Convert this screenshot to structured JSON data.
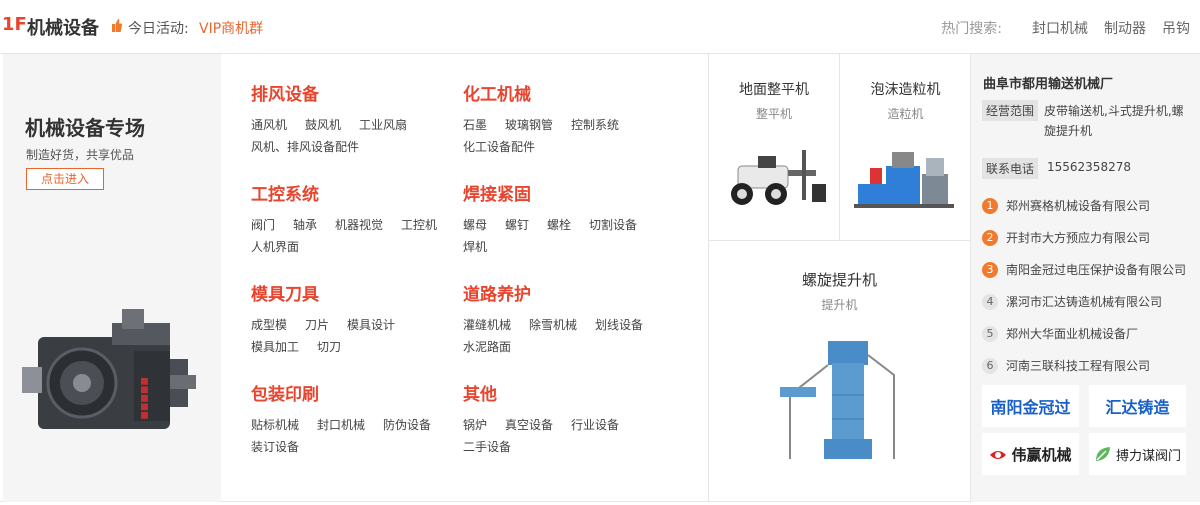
{
  "header": {
    "floor": "1F",
    "title": "机械设备",
    "activity_label": "今日活动:",
    "activity_link": "VIP商机群",
    "hot_label": "热门搜索:",
    "hot_items": [
      "封口机械",
      "制动器",
      "吊钩"
    ]
  },
  "promo": {
    "title": "机械设备专场",
    "subtitle": "制造好货，共享优品",
    "button": "点击进入",
    "image_icon": "indexer-machine-image"
  },
  "categories": [
    {
      "title": "排风设备",
      "links": [
        "通风机",
        "鼓风机",
        "工业风扇",
        "风机、排风设备配件"
      ]
    },
    {
      "title": "化工机械",
      "links": [
        "石墨",
        "玻璃钢管",
        "控制系统",
        "化工设备配件"
      ]
    },
    {
      "title": "工控系统",
      "links": [
        "阀门",
        "轴承",
        "机器视觉",
        "工控机",
        "人机界面"
      ]
    },
    {
      "title": "焊接紧固",
      "links": [
        "螺母",
        "螺钉",
        "螺栓",
        "切割设备",
        "焊机"
      ]
    },
    {
      "title": "模具刀具",
      "links": [
        "成型模",
        "刀片",
        "模具设计",
        "模具加工",
        "切刀"
      ]
    },
    {
      "title": "道路养护",
      "links": [
        "灌缝机械",
        "除雪机械",
        "划线设备",
        "水泥路面"
      ]
    },
    {
      "title": "包装印刷",
      "links": [
        "贴标机械",
        "封口机械",
        "防伪设备",
        "装订设备"
      ]
    },
    {
      "title": "其他",
      "links": [
        "锅炉",
        "真空设备",
        "行业设备",
        "二手设备"
      ]
    }
  ],
  "products": [
    {
      "name": "地面整平机",
      "sub": "整平机"
    },
    {
      "name": "泡沫造粒机",
      "sub": "造粒机"
    },
    {
      "name": "螺旋提升机",
      "sub": "提升机"
    }
  ],
  "merchant": {
    "name": "曲阜市都用输送机械厂",
    "scope_label": "经营范围",
    "scope_text": "皮带输送机,斗式提升机,螺旋提升机",
    "phone_label": "联系电话",
    "phone": "15562358278",
    "ranking": [
      "郑州赛格机械设备有限公司",
      "开封市大方预应力有限公司",
      "南阳金冠过电压保护设备有限公司",
      "漯河市汇达铸造机械有限公司",
      "郑州大华面业机械设备厂",
      "河南三联科技工程有限公司"
    ],
    "logos": [
      "南阳金冠过",
      "汇达铸造",
      "伟赢机械",
      "搏力谋阀门"
    ]
  },
  "colors": {
    "accent": "#e8452e",
    "orange": "#e8662e",
    "rank_top": "#f07a2e",
    "panel_bg": "#f5f5f5"
  }
}
